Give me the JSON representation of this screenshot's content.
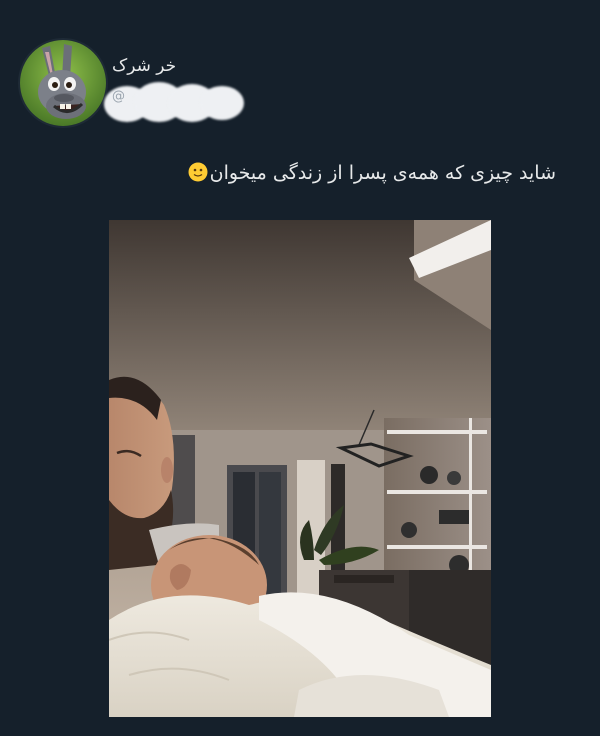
{
  "tweet": {
    "display_name": "خر شرک",
    "handle_prefix": "@",
    "text": "شاید چیزی که همه‌ی پسرا از زندگی میخوان",
    "emoji": "slightly-smiling-face-icon",
    "avatar": "donkey-avatar",
    "photo": "father-holding-sleeping-baby-photo"
  },
  "colors": {
    "background": "#15202b",
    "text": "#e7e9ea",
    "secondary_text": "#9aa4ae",
    "blur": "#eef0f3"
  }
}
